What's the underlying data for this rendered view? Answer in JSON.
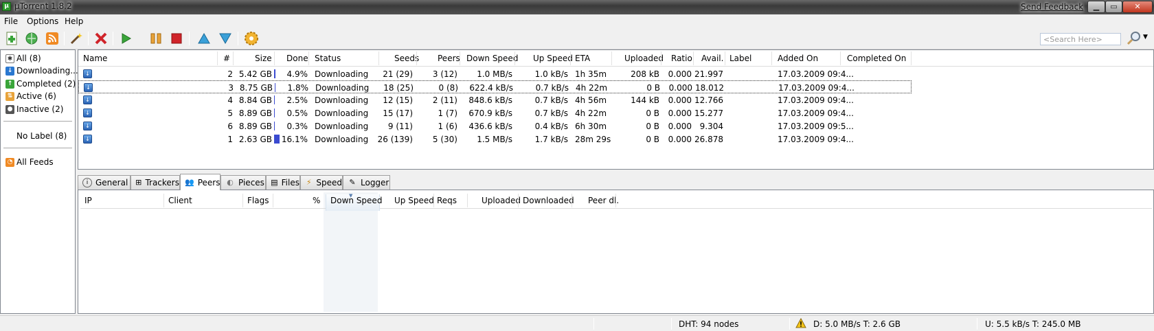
{
  "window": {
    "title": "µTorrent 1.8.2",
    "app_icon": "µ",
    "feedback": "Send Feedback",
    "min": "▁",
    "max": "▭",
    "close": "✕"
  },
  "menu": [
    "File",
    "Options",
    "Help"
  ],
  "search": {
    "placeholder": "<Search Here>"
  },
  "sidebar": {
    "items": [
      "All (8)",
      "Downloading...",
      "Completed (2)",
      "Active (6)",
      "Inactive (2)"
    ],
    "no_label": "No Label (8)",
    "feeds": "All Feeds"
  },
  "torrents": {
    "columns": [
      "Name",
      "#",
      "Size",
      "Done",
      "Status",
      "Seeds",
      "Peers",
      "Down Speed",
      "Up Speed",
      "ETA",
      "Uploaded",
      "Ratio",
      "Avail.",
      "Label",
      "Added On",
      "Completed On"
    ],
    "rows": [
      {
        "num": "2",
        "size": "5.42 GB",
        "done": "4.9%",
        "pct": 0.049,
        "status": "Downloading",
        "seeds": "21 (29)",
        "peers": "3 (12)",
        "down": "1.0 MB/s",
        "up": "1.0 kB/s",
        "eta": "1h 35m",
        "uploaded": "208 kB",
        "ratio": "0.000",
        "avail": "21.997",
        "added": "17.03.2009 09:4..."
      },
      {
        "num": "3",
        "size": "8.75 GB",
        "done": "1.8%",
        "pct": 0.018,
        "status": "Downloading",
        "seeds": "18 (25)",
        "peers": "0 (8)",
        "down": "622.4 kB/s",
        "up": "0.7 kB/s",
        "eta": "4h 22m",
        "uploaded": "0 B",
        "ratio": "0.000",
        "avail": "18.012",
        "added": "17.03.2009 09:4..."
      },
      {
        "num": "4",
        "size": "8.84 GB",
        "done": "2.5%",
        "pct": 0.025,
        "status": "Downloading",
        "seeds": "12 (15)",
        "peers": "2 (11)",
        "down": "848.6 kB/s",
        "up": "0.7 kB/s",
        "eta": "4h 56m",
        "uploaded": "144 kB",
        "ratio": "0.000",
        "avail": "12.766",
        "added": "17.03.2009 09:4..."
      },
      {
        "num": "5",
        "size": "8.89 GB",
        "done": "0.5%",
        "pct": 0.005,
        "status": "Downloading",
        "seeds": "15 (17)",
        "peers": "1 (7)",
        "down": "670.9 kB/s",
        "up": "0.7 kB/s",
        "eta": "4h 22m",
        "uploaded": "0 B",
        "ratio": "0.000",
        "avail": "15.277",
        "added": "17.03.2009 09:4..."
      },
      {
        "num": "6",
        "size": "8.89 GB",
        "done": "0.3%",
        "pct": 0.003,
        "status": "Downloading",
        "seeds": "9 (11)",
        "peers": "1 (6)",
        "down": "436.6 kB/s",
        "up": "0.4 kB/s",
        "eta": "6h 30m",
        "uploaded": "0 B",
        "ratio": "0.000",
        "avail": "9.304",
        "added": "17.03.2009 09:5..."
      },
      {
        "num": "1",
        "size": "2.63 GB",
        "done": "16.1%",
        "pct": 0.161,
        "status": "Downloading",
        "seeds": "26 (139)",
        "peers": "5 (30)",
        "down": "1.5 MB/s",
        "up": "1.7 kB/s",
        "eta": "28m 29s",
        "uploaded": "0 B",
        "ratio": "0.000",
        "avail": "26.878",
        "added": "17.03.2009 09:4..."
      }
    ]
  },
  "tabs": [
    "General",
    "Trackers",
    "Peers",
    "Pieces",
    "Files",
    "Speed",
    "Logger"
  ],
  "active_tab": "Peers",
  "peers": {
    "columns": [
      "IP",
      "Client",
      "Flags",
      "%",
      "Down Speed",
      "Up Speed",
      "Reqs",
      "Uploaded",
      "Downloaded",
      "Peer dl."
    ]
  },
  "status": {
    "dht": "DHT: 94 nodes",
    "down": "D: 5.0 MB/s T: 2.6 GB",
    "up": "U: 5.5 kB/s T: 245.0 MB"
  },
  "colors": {
    "progress": "#3b4bd0",
    "titlebar": "#3a3a3a"
  }
}
